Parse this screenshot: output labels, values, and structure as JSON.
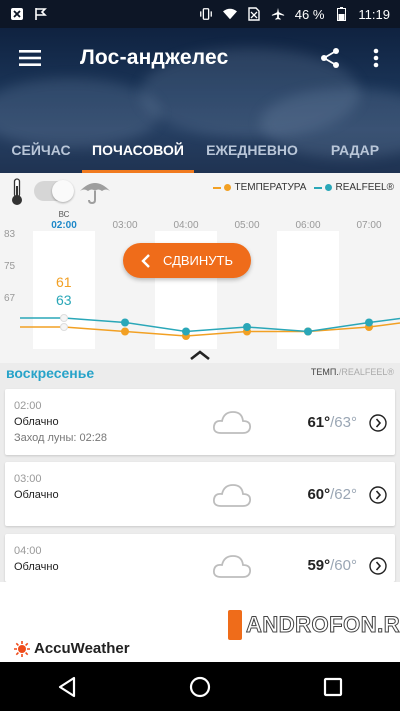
{
  "status_bar": {
    "battery": "46 %",
    "time": "11:19",
    "icons_left": [
      "close-box-icon",
      "checkmark-flag-icon"
    ],
    "icons_right": [
      "vibrate-icon",
      "wifi-icon",
      "no-sim-icon",
      "airplane-icon",
      "battery-icon"
    ]
  },
  "header": {
    "title": "Лос-анджелес",
    "icons": [
      "menu-icon",
      "share-icon",
      "more-vert-icon"
    ]
  },
  "tabs": [
    {
      "label": "СЕЙЧАС",
      "active": false
    },
    {
      "label": "ПОЧАСОВОЙ",
      "active": true
    },
    {
      "label": "ЕЖЕДНЕВНО",
      "active": false
    },
    {
      "label": "РАДАР",
      "active": false
    }
  ],
  "chart": {
    "legend": {
      "temperature": "ТЕМПЕРАТУРА",
      "realfeel": "REALFEEL®"
    },
    "current_day": "ВС",
    "slide_label": "СДВИНУТЬ",
    "current_temp": "61",
    "current_realfeel": "63",
    "colors": {
      "temperature": "#f2a023",
      "realfeel": "#2aa7b8",
      "accent": "#ef6c1a"
    }
  },
  "chart_data": {
    "type": "line",
    "x": [
      "02:00",
      "03:00",
      "04:00",
      "05:00",
      "06:00",
      "07:00"
    ],
    "y_ticks": [
      "83",
      "75",
      "67"
    ],
    "series": [
      {
        "name": "ТЕМПЕРАТУРА",
        "values": [
          61,
          60,
          59,
          60,
          60,
          61
        ]
      },
      {
        "name": "REALFEEL®",
        "values": [
          63,
          62,
          60,
          61,
          60,
          62
        ]
      }
    ]
  },
  "list": {
    "day": "воскресенье",
    "temp_key": "ТЕМП.",
    "realfeel_key": "/REALFEEL®",
    "items": [
      {
        "time": "02:00",
        "condition": "Облачно",
        "extra": "Заход луны: 02:28",
        "temp": "61°",
        "realfeel": "/63°"
      },
      {
        "time": "03:00",
        "condition": "Облачно",
        "extra": "",
        "temp": "60°",
        "realfeel": "/62°"
      },
      {
        "time": "04:00",
        "condition": "Облачно",
        "extra": "",
        "temp": "59°",
        "realfeel": "/60°"
      }
    ]
  },
  "footer": {
    "brand": "AccuWeather",
    "watermark": "ANDROFON.RU"
  }
}
